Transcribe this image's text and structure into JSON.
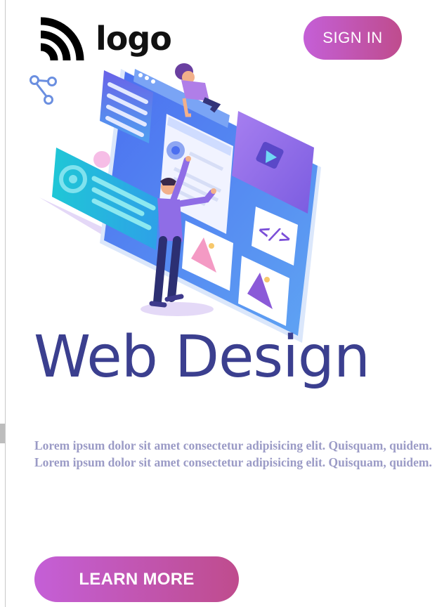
{
  "header": {
    "logo_icon": "rss-feed-icon",
    "logo_text": "logo",
    "sign_in_label": "SIGN IN"
  },
  "decor": {
    "share_icon": "share-icon"
  },
  "hero": {
    "illustration": "web-design-illustration",
    "headline": "Web Design",
    "body": "Lorem ipsum dolor sit amet consectetur adipisicing elit. Quisquam, quidem. Lorem ipsum dolor sit amet consectetur adipisicing elit. Quisquam, quidem.",
    "cta_label": "LEARN MORE",
    "code_glyph": "</>"
  },
  "colors": {
    "headline": "#3b3f8f",
    "body_text": "#9b9bc6",
    "button_gradient_start": "#c45fd7",
    "button_gradient_end": "#bf4c8d"
  }
}
